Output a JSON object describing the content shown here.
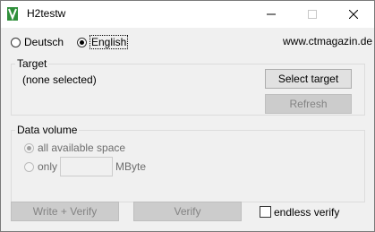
{
  "window": {
    "title": "H2testw",
    "icon": "h2testw-app-icon",
    "controls": {
      "minimize": "minimize-icon",
      "maximize": "maximize-icon",
      "close": "close-icon"
    }
  },
  "language": {
    "options": [
      "Deutsch",
      "English"
    ],
    "selected": "English"
  },
  "website": "www.ctmagazin.de",
  "target_group": {
    "legend": "Target",
    "status": "(none selected)",
    "select_button": "Select target",
    "refresh_button": "Refresh"
  },
  "data_volume_group": {
    "legend": "Data volume",
    "option_all": "all available space",
    "option_only": "only",
    "only_value": "",
    "unit": "MByte"
  },
  "actions": {
    "write_verify": "Write + Verify",
    "verify": "Verify",
    "endless_verify": "endless verify",
    "endless_checked": false
  }
}
